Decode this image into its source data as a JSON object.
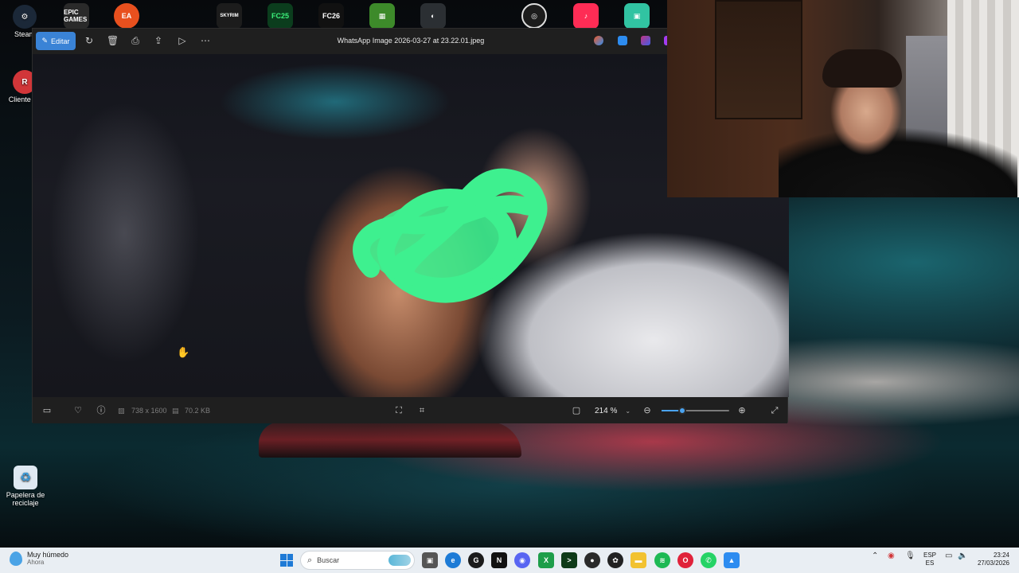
{
  "desktop": {
    "icons": [
      {
        "label": "Steam",
        "icon": "steam-icon",
        "color": "#1b2838"
      },
      {
        "label": "Cliente de",
        "icon": "riot-client-icon",
        "color": "#d13639"
      },
      {
        "label": "Papelera de reciclaje",
        "icon": "recycle-bin-icon",
        "color": "#3a9ad9"
      }
    ],
    "top_row": [
      {
        "label": "EPIC GAMES",
        "icon": "epic-games-icon",
        "color": "#2a2a2a"
      },
      {
        "label": "EA",
        "icon": "ea-icon",
        "color": "#e8501e"
      },
      {
        "label": "SKYRIM",
        "icon": "skyrim-icon",
        "color": "#1c1c1c"
      },
      {
        "label": "FC25",
        "icon": "fc25-icon",
        "color": "#0b3d1d"
      },
      {
        "label": "FC26",
        "icon": "fc26-icon",
        "color": "#111111"
      },
      {
        "label": "",
        "icon": "minecraft-icon",
        "color": "#3d8a2a"
      },
      {
        "label": "",
        "icon": "game-icon",
        "color": "#2b2f33"
      },
      {
        "label": "",
        "icon": "obs-icon",
        "color": "#1c1c1c"
      },
      {
        "label": "",
        "icon": "tiktok-live-icon",
        "color": "#fe2c55"
      },
      {
        "label": "",
        "icon": "streamlabs-icon",
        "color": "#31c3a2"
      }
    ]
  },
  "viewer": {
    "edit_label": "Editar",
    "file_title": "WhatsApp Image 2026-03-27 at 23.22.01.jpeg",
    "dimensions": "738 x 1600",
    "file_size": "70.2 KB",
    "zoom": "214 %",
    "zoom_level": 0.3,
    "accent": "#3a83d6"
  },
  "taskbar": {
    "weather_title": "Muy húmedo",
    "weather_sub": "Ahora",
    "search_placeholder": "Buscar",
    "lang_1": "ESP",
    "lang_2": "ES",
    "time": "23:24",
    "date": "27/03/2026"
  }
}
